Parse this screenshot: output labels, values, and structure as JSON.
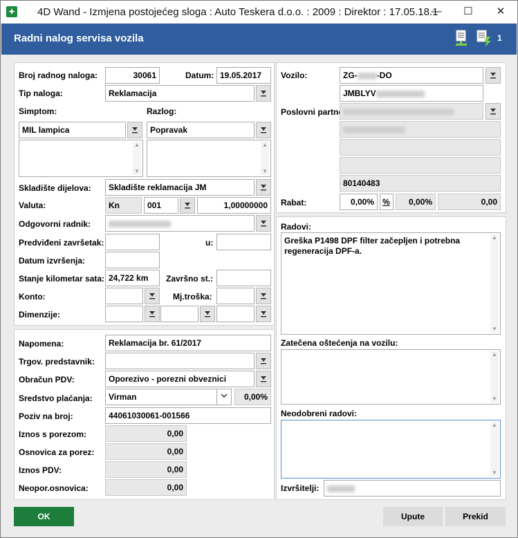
{
  "window": {
    "title": "4D Wand - Izmjena postojećeg sloga : Auto Teskera d.o.o. : 2009 : Direktor : 17.05.18.1",
    "minimize": "—",
    "maximize": "☐",
    "close": "✕"
  },
  "header": {
    "title": "Radni nalog servisa vozila",
    "badge_count": "1"
  },
  "left": {
    "broj_label": "Broj radnog naloga:",
    "broj_value": "30061",
    "datum_label": "Datum:",
    "datum_value": "19.05.2017",
    "tip_label": "Tip naloga:",
    "tip_value": "Reklamacija",
    "simptom_label": "Simptom:",
    "simptom_value": "MIL lampica",
    "razlog_label": "Razlog:",
    "razlog_value": "Popravak",
    "skladiste_label": "Skladište dijelova:",
    "skladiste_value": "Skladište reklamacija JM",
    "valuta_label": "Valuta:",
    "valuta_code": "Kn",
    "valuta_num": "001",
    "valuta_rate": "1,00000000",
    "radnik_label": "Odgovorni radnik:",
    "predvideni_label": "Predviđeni završetak:",
    "u_label": "u:",
    "datum_izvrsenja_label": "Datum izvršenja:",
    "km_label": "Stanje kilometar sata:",
    "km_value": "24,722 km",
    "zavrsno_label": "Završno st.:",
    "konto_label": "Konto:",
    "mjtroska_label": "Mj.troška:",
    "dimenzije_label": "Dimenzije:"
  },
  "bottom_left": {
    "napomena_label": "Napomena:",
    "napomena_value": "Reklamacija br. 61/2017",
    "trgov_label": "Trgov. predstavnik:",
    "obracun_label": "Obračun PDV:",
    "obracun_value": "Oporezivo - porezni obveznici",
    "sredstvo_label": "Sredstvo plaćanja:",
    "sredstvo_value": "Virman",
    "sredstvo_pct": "0,00%",
    "poziv_label": "Poziv na broj:",
    "poziv_value": "44061030061-001566",
    "iznos_label": "Iznos s porezom:",
    "iznos_value": "0,00",
    "osnovica_label": "Osnovica za porez:",
    "osnovica_value": "0,00",
    "iznospdv_label": "Iznos PDV:",
    "iznospdv_value": "0,00",
    "neopor_label": "Neopor.osnovica:",
    "neopor_value": "0,00"
  },
  "right": {
    "vozilo_label": "Vozilo:",
    "vozilo_prefix": "ZG-",
    "vozilo_suffix": "-DO",
    "vin_prefix": "JMBLYV",
    "partner_label": "Poslovni partner:",
    "partner_id": "80140483",
    "rabat_label": "Rabat:",
    "rabat_pct": "0,00%",
    "rabat_pct_btn": "%",
    "rabat_pct2": "0,00%",
    "rabat_amount": "0,00"
  },
  "right_lower": {
    "radovi_label": "Radovi:",
    "radovi_text": "Greška P1498 DPF filter začepljen  i potrebna regeneracija DPF-a.",
    "ostecenja_label": "Zatečena oštećenja na vozilu:",
    "neodobreni_label": "Neodobreni radovi:",
    "izvrsitelji_label": "Izvršitelji:"
  },
  "buttons": {
    "ok": "OK",
    "upute": "Upute",
    "prekid": "Prekid"
  },
  "colors": {
    "header": "#2f5d9e",
    "ok_button": "#1d7d3a",
    "window_bg": "#ececec"
  }
}
